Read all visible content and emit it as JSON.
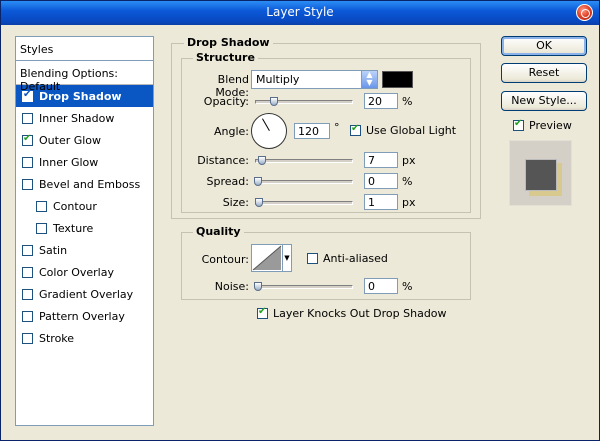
{
  "window": {
    "title": "Layer Style"
  },
  "styles_panel": {
    "header": "Styles",
    "blending_options": "Blending Options: Default",
    "items": [
      {
        "label": "Drop Shadow",
        "checked": true,
        "active": true,
        "sub": false
      },
      {
        "label": "Inner Shadow",
        "checked": false,
        "active": false,
        "sub": false
      },
      {
        "label": "Outer Glow",
        "checked": true,
        "active": false,
        "sub": false
      },
      {
        "label": "Inner Glow",
        "checked": false,
        "active": false,
        "sub": false
      },
      {
        "label": "Bevel and Emboss",
        "checked": false,
        "active": false,
        "sub": false
      },
      {
        "label": "Contour",
        "checked": false,
        "active": false,
        "sub": true
      },
      {
        "label": "Texture",
        "checked": false,
        "active": false,
        "sub": true
      },
      {
        "label": "Satin",
        "checked": false,
        "active": false,
        "sub": false
      },
      {
        "label": "Color Overlay",
        "checked": false,
        "active": false,
        "sub": false
      },
      {
        "label": "Gradient Overlay",
        "checked": false,
        "active": false,
        "sub": false
      },
      {
        "label": "Pattern Overlay",
        "checked": false,
        "active": false,
        "sub": false
      },
      {
        "label": "Stroke",
        "checked": false,
        "active": false,
        "sub": false
      }
    ]
  },
  "drop_shadow": {
    "title": "Drop Shadow",
    "structure": {
      "title": "Structure",
      "blend_mode_label": "Blend Mode:",
      "blend_mode_value": "Multiply",
      "shadow_color": "#000000",
      "opacity_label": "Opacity:",
      "opacity_value": "20",
      "opacity_unit": "%",
      "angle_label": "Angle:",
      "angle_value": "120",
      "angle_unit": "°",
      "use_global_light_label": "Use Global Light",
      "use_global_light_checked": true,
      "distance_label": "Distance:",
      "distance_value": "7",
      "distance_unit": "px",
      "spread_label": "Spread:",
      "spread_value": "0",
      "spread_unit": "%",
      "size_label": "Size:",
      "size_value": "1",
      "size_unit": "px"
    },
    "quality": {
      "title": "Quality",
      "contour_label": "Contour:",
      "anti_aliased_label": "Anti-aliased",
      "anti_aliased_checked": false,
      "noise_label": "Noise:",
      "noise_value": "0",
      "noise_unit": "%"
    },
    "knocks_out_label": "Layer Knocks Out Drop Shadow",
    "knocks_out_checked": true
  },
  "buttons": {
    "ok": "OK",
    "reset": "Reset",
    "new_style": "New Style..."
  },
  "preview": {
    "label": "Preview",
    "checked": true
  }
}
